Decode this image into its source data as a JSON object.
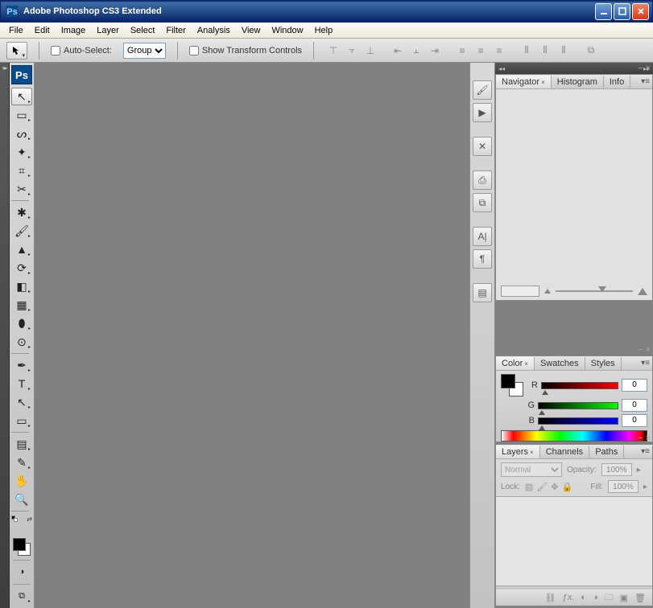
{
  "window": {
    "title": "Adobe Photoshop CS3 Extended",
    "buttons": {
      "min": "_",
      "max": "□",
      "close": "X"
    }
  },
  "menu": [
    "File",
    "Edit",
    "Image",
    "Layer",
    "Select",
    "Filter",
    "Analysis",
    "View",
    "Window",
    "Help"
  ],
  "options": {
    "auto_select_label": "Auto-Select:",
    "auto_select_checked": false,
    "auto_select_mode": "Group",
    "show_transform_label": "Show Transform Controls",
    "show_transform_checked": false
  },
  "toolbox": {
    "logo": "Ps",
    "tools": [
      {
        "name": "move-tool",
        "glyph": "↖",
        "sub": true,
        "selected": true
      },
      {
        "name": "marquee-tool",
        "glyph": "▭",
        "sub": true
      },
      {
        "name": "lasso-tool",
        "glyph": "ᔕ",
        "sub": true
      },
      {
        "name": "magic-wand-tool",
        "glyph": "✦",
        "sub": true
      },
      {
        "name": "crop-tool",
        "glyph": "⌗",
        "sub": true
      },
      {
        "name": "slice-tool",
        "glyph": "✂",
        "sub": true
      },
      {
        "name": "sep"
      },
      {
        "name": "healing-brush-tool",
        "glyph": "✱",
        "sub": true
      },
      {
        "name": "brush-tool",
        "glyph": "🖌",
        "sub": true
      },
      {
        "name": "clone-stamp-tool",
        "glyph": "▲",
        "sub": true
      },
      {
        "name": "history-brush-tool",
        "glyph": "⟳",
        "sub": true
      },
      {
        "name": "eraser-tool",
        "glyph": "◧",
        "sub": true
      },
      {
        "name": "gradient-tool",
        "glyph": "▦",
        "sub": true
      },
      {
        "name": "blur-tool",
        "glyph": "⬮",
        "sub": true
      },
      {
        "name": "dodge-tool",
        "glyph": "⊙",
        "sub": true
      },
      {
        "name": "sep"
      },
      {
        "name": "pen-tool",
        "glyph": "✒",
        "sub": true
      },
      {
        "name": "type-tool",
        "glyph": "T",
        "sub": true
      },
      {
        "name": "path-selection-tool",
        "glyph": "↖",
        "sub": true
      },
      {
        "name": "shape-tool",
        "glyph": "▭",
        "sub": true
      },
      {
        "name": "sep"
      },
      {
        "name": "notes-tool",
        "glyph": "▤",
        "sub": true
      },
      {
        "name": "eyedropper-tool",
        "glyph": "✎",
        "sub": true
      },
      {
        "name": "hand-tool",
        "glyph": "✋",
        "sub": false
      },
      {
        "name": "zoom-tool",
        "glyph": "🔍",
        "sub": false
      },
      {
        "name": "sep"
      }
    ],
    "quickmask": "◑",
    "screenmode": "⧉"
  },
  "panels": {
    "navigator": {
      "tabs": [
        {
          "label": "Navigator",
          "active": true
        },
        {
          "label": "Histogram"
        },
        {
          "label": "Info"
        }
      ]
    },
    "color": {
      "tabs": [
        {
          "label": "Color",
          "active": true
        },
        {
          "label": "Swatches"
        },
        {
          "label": "Styles"
        }
      ],
      "channels": [
        {
          "key": "R",
          "value": "0"
        },
        {
          "key": "G",
          "value": "0"
        },
        {
          "key": "B",
          "value": "0"
        }
      ]
    },
    "layers": {
      "tabs": [
        {
          "label": "Layers",
          "active": true
        },
        {
          "label": "Channels"
        },
        {
          "label": "Paths"
        }
      ],
      "blend_mode": "Normal",
      "opacity_label": "Opacity:",
      "opacity_value": "100%",
      "lock_label": "Lock:",
      "fill_label": "Fill:",
      "fill_value": "100%"
    }
  }
}
